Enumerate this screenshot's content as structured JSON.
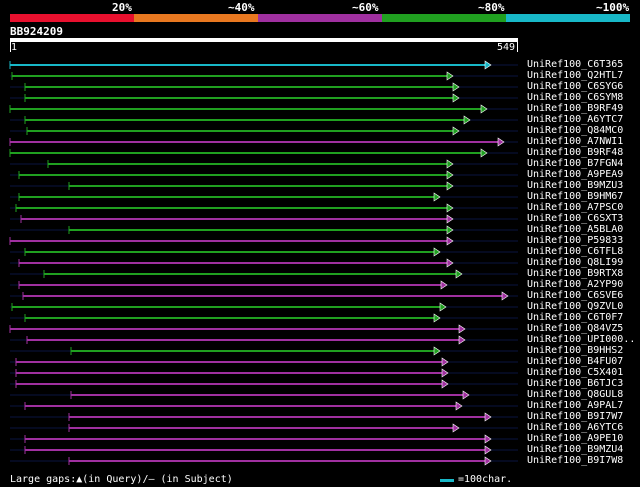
{
  "legend": {
    "labels": [
      "20%",
      "~40%",
      "~60%",
      "~80%",
      "~100%"
    ],
    "colors": [
      "#e8102e",
      "#e87820",
      "#a030a0",
      "#20a020",
      "#18b8c8"
    ]
  },
  "query": {
    "name": "BB924209",
    "start": "1",
    "end": "549"
  },
  "hits": [
    {
      "id": "UniRef100_C6T365",
      "color": "#18b8c8",
      "end": 491,
      "start": 10
    },
    {
      "id": "UniRef100_Q2HTL7",
      "color": "#20a020",
      "end": 453,
      "start": 12
    },
    {
      "id": "UniRef100_C6SYG6",
      "color": "#20a020",
      "end": 459,
      "start": 25
    },
    {
      "id": "UniRef100_C6SYM8",
      "color": "#20a020",
      "end": 459,
      "start": 25
    },
    {
      "id": "UniRef100_B9RF49",
      "color": "#20a020",
      "end": 487,
      "start": 10
    },
    {
      "id": "UniRef100_A6YTC7",
      "color": "#20a020",
      "end": 470,
      "start": 25
    },
    {
      "id": "UniRef100_Q84MC0",
      "color": "#20a020",
      "end": 459,
      "start": 27
    },
    {
      "id": "UniRef100_A7NWI1",
      "color": "#a030a0",
      "end": 504,
      "start": 10
    },
    {
      "id": "UniRef100_B9RF48",
      "color": "#20a020",
      "end": 487,
      "start": 10
    },
    {
      "id": "UniRef100_B7FGN4",
      "color": "#20a020",
      "end": 453,
      "start": 48
    },
    {
      "id": "UniRef100_A9PEA9",
      "color": "#20a020",
      "end": 453,
      "start": 19
    },
    {
      "id": "UniRef100_B9MZU3",
      "color": "#20a020",
      "end": 453,
      "start": 69
    },
    {
      "id": "UniRef100_B9HM67",
      "color": "#20a020",
      "end": 440,
      "start": 19
    },
    {
      "id": "UniRef100_A7PSC0",
      "color": "#20a020",
      "end": 453,
      "start": 16
    },
    {
      "id": "UniRef100_C6SXT3",
      "color": "#a030a0",
      "end": 453,
      "start": 21
    },
    {
      "id": "UniRef100_A5BLA0",
      "color": "#20a020",
      "end": 453,
      "start": 69
    },
    {
      "id": "UniRef100_P59833",
      "color": "#a030a0",
      "end": 453,
      "start": 10
    },
    {
      "id": "UniRef100_C6TFL8",
      "color": "#20a020",
      "end": 440,
      "start": 25
    },
    {
      "id": "UniRef100_Q8LI99",
      "color": "#a030a0",
      "end": 453,
      "start": 19
    },
    {
      "id": "UniRef100_B9RTX8",
      "color": "#20a020",
      "end": 462,
      "start": 44
    },
    {
      "id": "UniRef100_A2YP90",
      "color": "#a030a0",
      "end": 447,
      "start": 19
    },
    {
      "id": "UniRef100_C6SVE6",
      "color": "#a030a0",
      "end": 508,
      "start": 23
    },
    {
      "id": "UniRef100_Q9ZVL0",
      "color": "#20a020",
      "end": 446,
      "start": 12
    },
    {
      "id": "UniRef100_C6T0F7",
      "color": "#20a020",
      "end": 440,
      "start": 25
    },
    {
      "id": "UniRef100_Q84VZ5",
      "color": "#a030a0",
      "end": 465,
      "start": 10
    },
    {
      "id": "UniRef100_UPI000..",
      "color": "#a030a0",
      "end": 465,
      "start": 27
    },
    {
      "id": "UniRef100_B9HHS2",
      "color": "#20a020",
      "end": 440,
      "start": 71
    },
    {
      "id": "UniRef100_B4FU07",
      "color": "#a030a0",
      "end": 448,
      "start": 16
    },
    {
      "id": "UniRef100_C5X401",
      "color": "#a030a0",
      "end": 448,
      "start": 16
    },
    {
      "id": "UniRef100_B6TJC3",
      "color": "#a030a0",
      "end": 448,
      "start": 16
    },
    {
      "id": "UniRef100_Q8GUL8",
      "color": "#a030a0",
      "end": 469,
      "start": 71
    },
    {
      "id": "UniRef100_A9PAL7",
      "color": "#a030a0",
      "end": 462,
      "start": 25
    },
    {
      "id": "UniRef100_B9I7W7",
      "color": "#a030a0",
      "end": 491,
      "start": 69
    },
    {
      "id": "UniRef100_A6YTC6",
      "color": "#a030a0",
      "end": 459,
      "start": 69
    },
    {
      "id": "UniRef100_A9PE10",
      "color": "#a030a0",
      "end": 491,
      "start": 25
    },
    {
      "id": "UniRef100_B9MZU4",
      "color": "#a030a0",
      "end": 491,
      "start": 25
    },
    {
      "id": "UniRef100_B9I7W8",
      "color": "#a030a0",
      "end": 491,
      "start": 69
    }
  ],
  "footer": {
    "text": "Large gaps:▲(in Query)/– (in Subject)",
    "scale_label": "=100char."
  }
}
